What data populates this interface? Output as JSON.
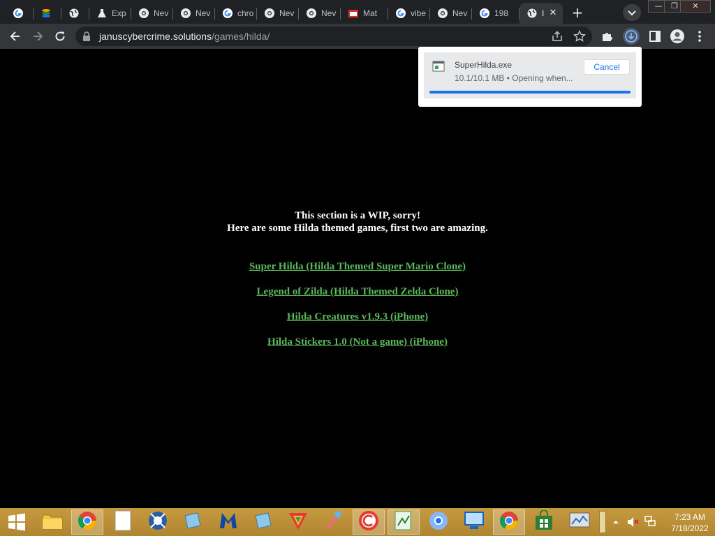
{
  "browser": {
    "tabs": [
      {
        "favicon": "google-icon",
        "title": ""
      },
      {
        "favicon": "stack-icon",
        "title": ""
      },
      {
        "favicon": "globe-icon",
        "title": ""
      },
      {
        "favicon": "flask-icon",
        "title": "Exp"
      },
      {
        "favicon": "chrome-icon",
        "title": "Nev"
      },
      {
        "favicon": "chrome-icon",
        "title": "Nev"
      },
      {
        "favicon": "google-icon",
        "title": "chro"
      },
      {
        "favicon": "chrome-icon",
        "title": "Nev"
      },
      {
        "favicon": "chrome-icon",
        "title": "Nev"
      },
      {
        "favicon": "mat-icon",
        "title": "Mat"
      },
      {
        "favicon": "google-icon",
        "title": "vibe"
      },
      {
        "favicon": "chrome-icon",
        "title": "Nev"
      },
      {
        "favicon": "google-icon",
        "title": "198"
      },
      {
        "favicon": "globe-icon",
        "title": "I"
      }
    ],
    "active_tab_index": 13,
    "new_tab_label": "+",
    "window_controls": {
      "minimize": "—",
      "restore": "❐",
      "close": "✕"
    },
    "url_host": "januscybercrime.solutions",
    "url_path": "/games/hilda/"
  },
  "page": {
    "heading_line1": "This section is a WIP, sorry!",
    "heading_line2": "Here are some Hilda themed games, first two are amazing.",
    "links": [
      "Super Hilda (Hilda Themed Super Mario Clone)",
      "Legend of Zilda (Hilda Themed Zelda Clone)",
      "Hilda Creatures v1.9.3 (iPhone)",
      "Hilda Stickers 1.0 (Not a game) (iPhone)"
    ],
    "link_color": "#5ab85a"
  },
  "download": {
    "filename": "SuperHilda.exe",
    "status": "10.1/10.1 MB • Opening when...",
    "cancel_label": "Cancel",
    "progress": 1.0
  },
  "taskbar": {
    "apps": [
      "file-explorer-icon",
      "chrome-icon",
      "notepad-icon",
      "bug-app-icon",
      "blue-app-icon",
      "malwarebytes-icon",
      "blue-app-icon",
      "colorful-app-icon",
      "paint-icon",
      "ccleaner-icon",
      "notepadpp-icon",
      "chromium-icon",
      "remote-desktop-icon",
      "chrome-icon",
      "store-icon",
      "monitor-app-icon"
    ],
    "time": "7:23 AM",
    "date": "7/18/2022"
  }
}
